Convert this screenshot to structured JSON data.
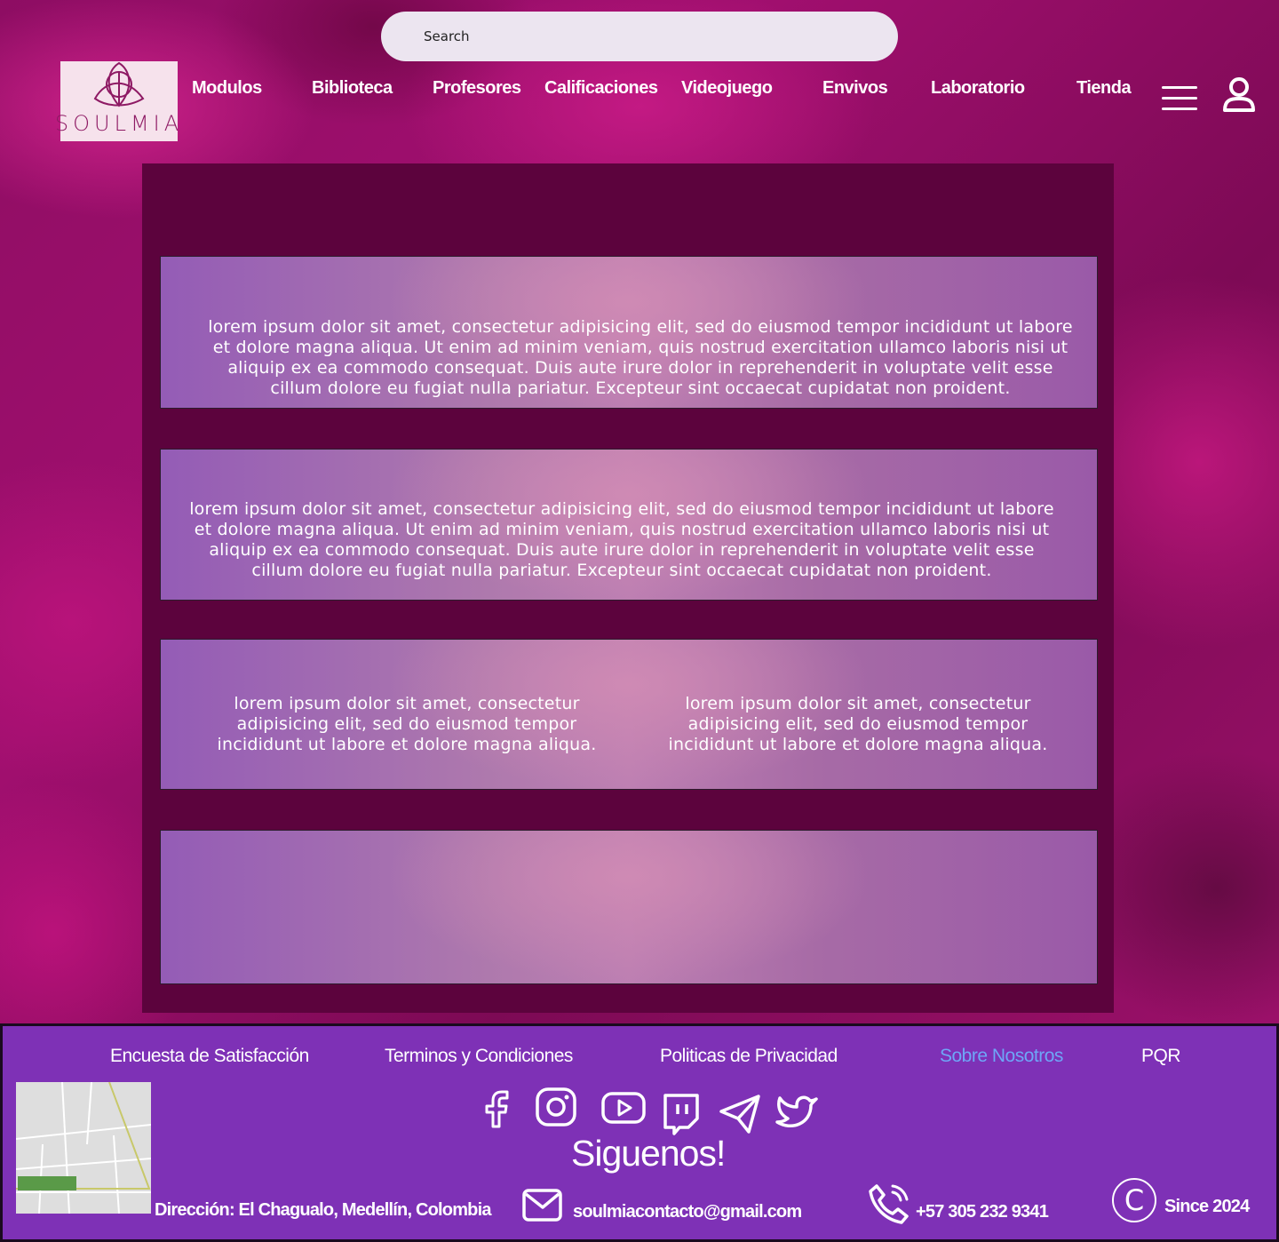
{
  "search": {
    "placeholder": "Search"
  },
  "brand": {
    "name": "SOULMIA"
  },
  "nav": {
    "items": [
      {
        "label": "Modulos"
      },
      {
        "label": "Biblioteca"
      },
      {
        "label": "Profesores"
      },
      {
        "label": "Calificaciones"
      },
      {
        "label": "Videojuego"
      },
      {
        "label": "Envivos"
      },
      {
        "label": "Laboratorio"
      },
      {
        "label": "Tienda"
      }
    ],
    "menu_icon": "hamburger-menu-icon",
    "user_icon": "user-icon"
  },
  "content": {
    "card1_text": "lorem ipsum dolor sit amet, consectetur adipisicing elit, sed do eiusmod tempor incididunt ut labore et dolore magna aliqua. Ut enim ad minim veniam, quis nostrud exercitation ullamco laboris nisi ut aliquip ex ea commodo consequat. Duis aute irure dolor in reprehenderit in voluptate velit esse cillum dolore eu fugiat nulla pariatur. Excepteur sint occaecat cupidatat non proident.",
    "card2_text": "lorem ipsum dolor sit amet, consectetur adipisicing elit, sed do eiusmod tempor incididunt ut labore et dolore magna aliqua. Ut enim ad minim veniam, quis nostrud exercitation ullamco laboris nisi ut aliquip ex ea commodo consequat. Duis aute irure dolor in reprehenderit in voluptate velit esse cillum dolore eu fugiat nulla pariatur. Excepteur sint occaecat cupidatat non proident.",
    "card3_col1": "lorem ipsum dolor sit amet, consectetur adipisicing elit, sed do eiusmod tempor incididunt ut labore et dolore magna aliqua.",
    "card3_col2": "lorem ipsum dolor sit amet, consectetur adipisicing elit, sed do eiusmod tempor incididunt ut labore et dolore magna aliqua."
  },
  "footer": {
    "links": [
      {
        "label": "Encuesta de Satisfacción"
      },
      {
        "label": "Terminos y Condiciones"
      },
      {
        "label": "Politicas de Privacidad"
      },
      {
        "label": "Sobre Nosotros"
      },
      {
        "label": "PQR"
      }
    ],
    "social_icons": [
      "facebook-icon",
      "instagram-icon",
      "youtube-icon",
      "twitch-icon",
      "telegram-icon",
      "twitter-icon"
    ],
    "follow_text": "Siguenos!",
    "address": "Dirección: El Chagualo, Medellín, Colombia",
    "email": "soulmiacontacto@gmail.com",
    "phone": "+57 305 232 9341",
    "since": "Since 2024",
    "colors": {
      "footer_bg": "#7e31b6",
      "active_link": "#6ea6f7",
      "panel_bg": "#5c033d"
    }
  }
}
